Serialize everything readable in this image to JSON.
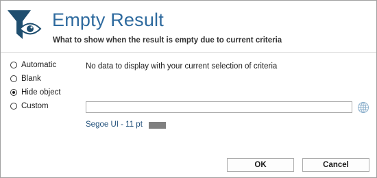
{
  "header": {
    "title": "Empty Result",
    "subtitle": "What to show when the result is empty due to current criteria",
    "icon": "filter-eye-icon",
    "accent_color": "#2e6a9e"
  },
  "options": {
    "items": [
      {
        "label": "Automatic",
        "checked": false
      },
      {
        "label": "Blank",
        "checked": false
      },
      {
        "label": "Hide object",
        "checked": true
      },
      {
        "label": "Custom",
        "checked": false
      }
    ]
  },
  "preview": {
    "text": "No data to display with your current selection of criteria"
  },
  "custom": {
    "value": "",
    "globe_icon": "globe-icon"
  },
  "font": {
    "label": "Segoe UI - 11 pt",
    "color": "#808080"
  },
  "buttons": {
    "ok": "OK",
    "cancel": "Cancel"
  }
}
